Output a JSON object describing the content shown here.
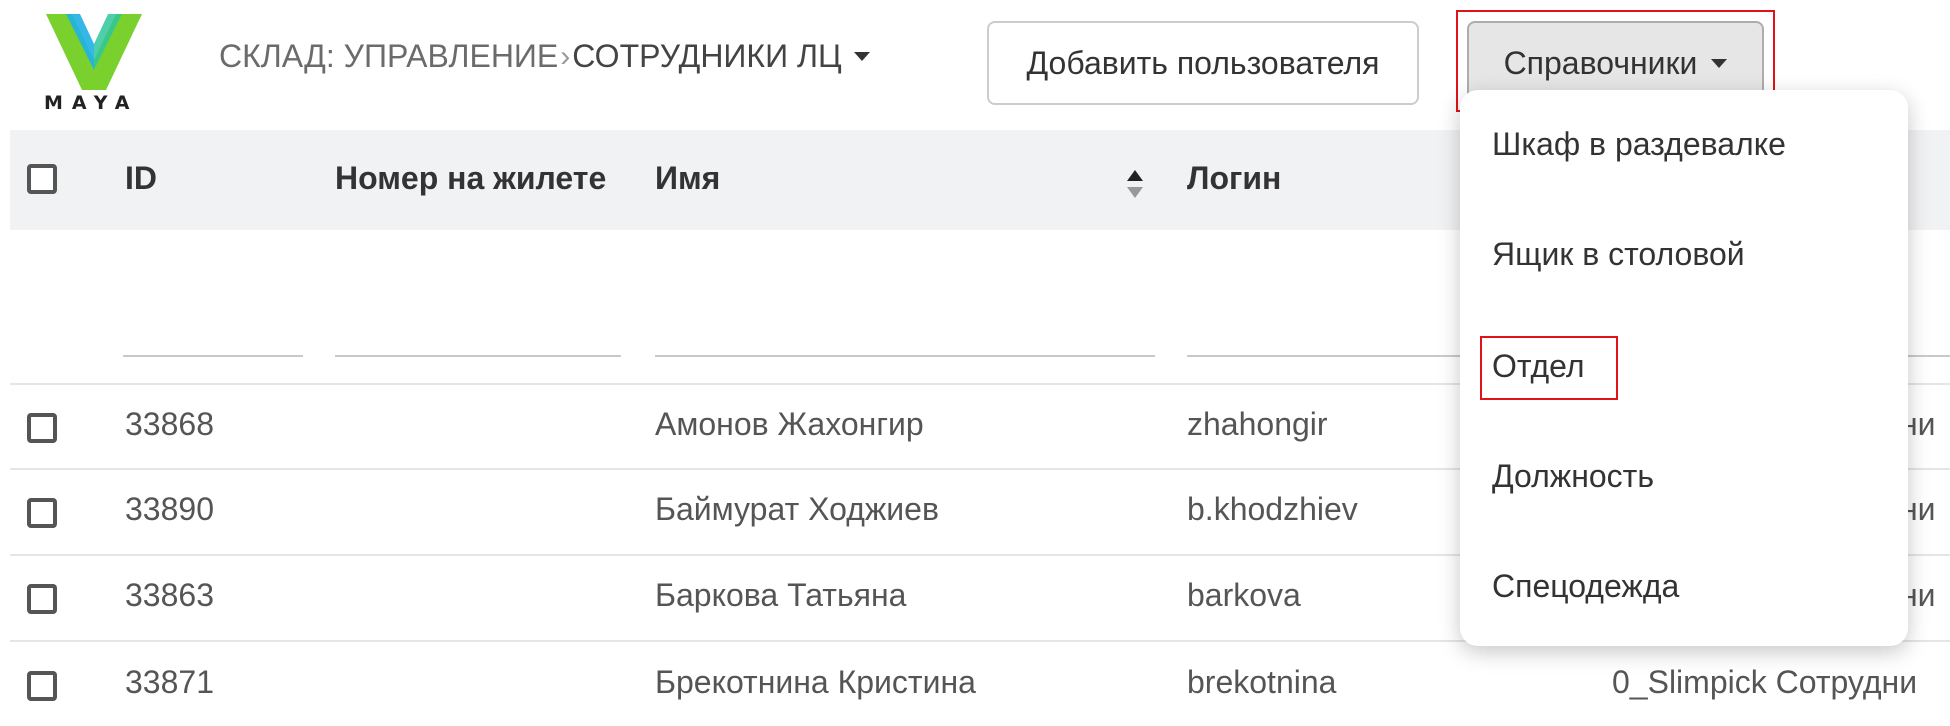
{
  "brand": {
    "logo_text": "MAYA",
    "accent_color": "#6fcf2e",
    "accent_blue": "#1fb0e6"
  },
  "breadcrumb": {
    "section": "СКЛАД: УПРАВЛЕНИЕ",
    "separator": "›",
    "current": "СОТРУДНИКИ ЛЦ"
  },
  "toolbar": {
    "add_user_label": "Добавить пользователя",
    "references_label": "Справочники"
  },
  "table": {
    "columns": [
      "ID",
      "Номер на жилете",
      "Имя",
      "Логин"
    ],
    "rows": [
      {
        "id": "33868",
        "vest": "",
        "name": "Амонов Жахонгир",
        "login": "zhahongir",
        "extra": "ни"
      },
      {
        "id": "33890",
        "vest": "",
        "name": "Баймурат Ходжиев",
        "login": "b.khodzhiev",
        "extra": "ни"
      },
      {
        "id": "33863",
        "vest": "",
        "name": "Баркова Татьяна",
        "login": "barkova",
        "extra": "ни"
      },
      {
        "id": "33871",
        "vest": "",
        "name": "Брекотнина Кристина",
        "login": "brekotnina",
        "extra": "0_Slimpick Сотрудни"
      }
    ]
  },
  "dropdown": {
    "items": [
      "Шкаф в раздевалке",
      "Ящик в столовой",
      "Отдел",
      "Должность",
      "Спецодежда"
    ],
    "highlighted_item": "Отдел"
  },
  "highlight_color": "#e0121a"
}
